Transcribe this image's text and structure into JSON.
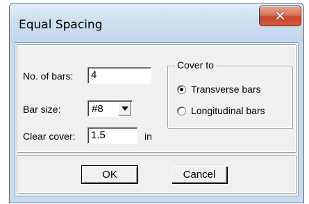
{
  "window": {
    "title": "Equal Spacing",
    "close_glyph": "✕",
    "close_icon": "close-icon"
  },
  "fields": {
    "no_of_bars_label": "No. of bars:",
    "no_of_bars_value": "4",
    "bar_size_label": "Bar size:",
    "bar_size_value": "#8",
    "bar_size_icon": "chevron-down-icon",
    "clear_cover_label": "Clear cover:",
    "clear_cover_value": "1.5",
    "clear_cover_unit": "in"
  },
  "cover_to": {
    "legend": "Cover to",
    "options": [
      {
        "label": "Transverse bars",
        "selected": true
      },
      {
        "label": "Longitudinal bars",
        "selected": false
      }
    ]
  },
  "buttons": {
    "ok": "OK",
    "cancel": "Cancel"
  },
  "colors": {
    "title_bar": "#cfdfef",
    "close_button": "#c8452c",
    "dialog_face": "#f0f0f0"
  }
}
